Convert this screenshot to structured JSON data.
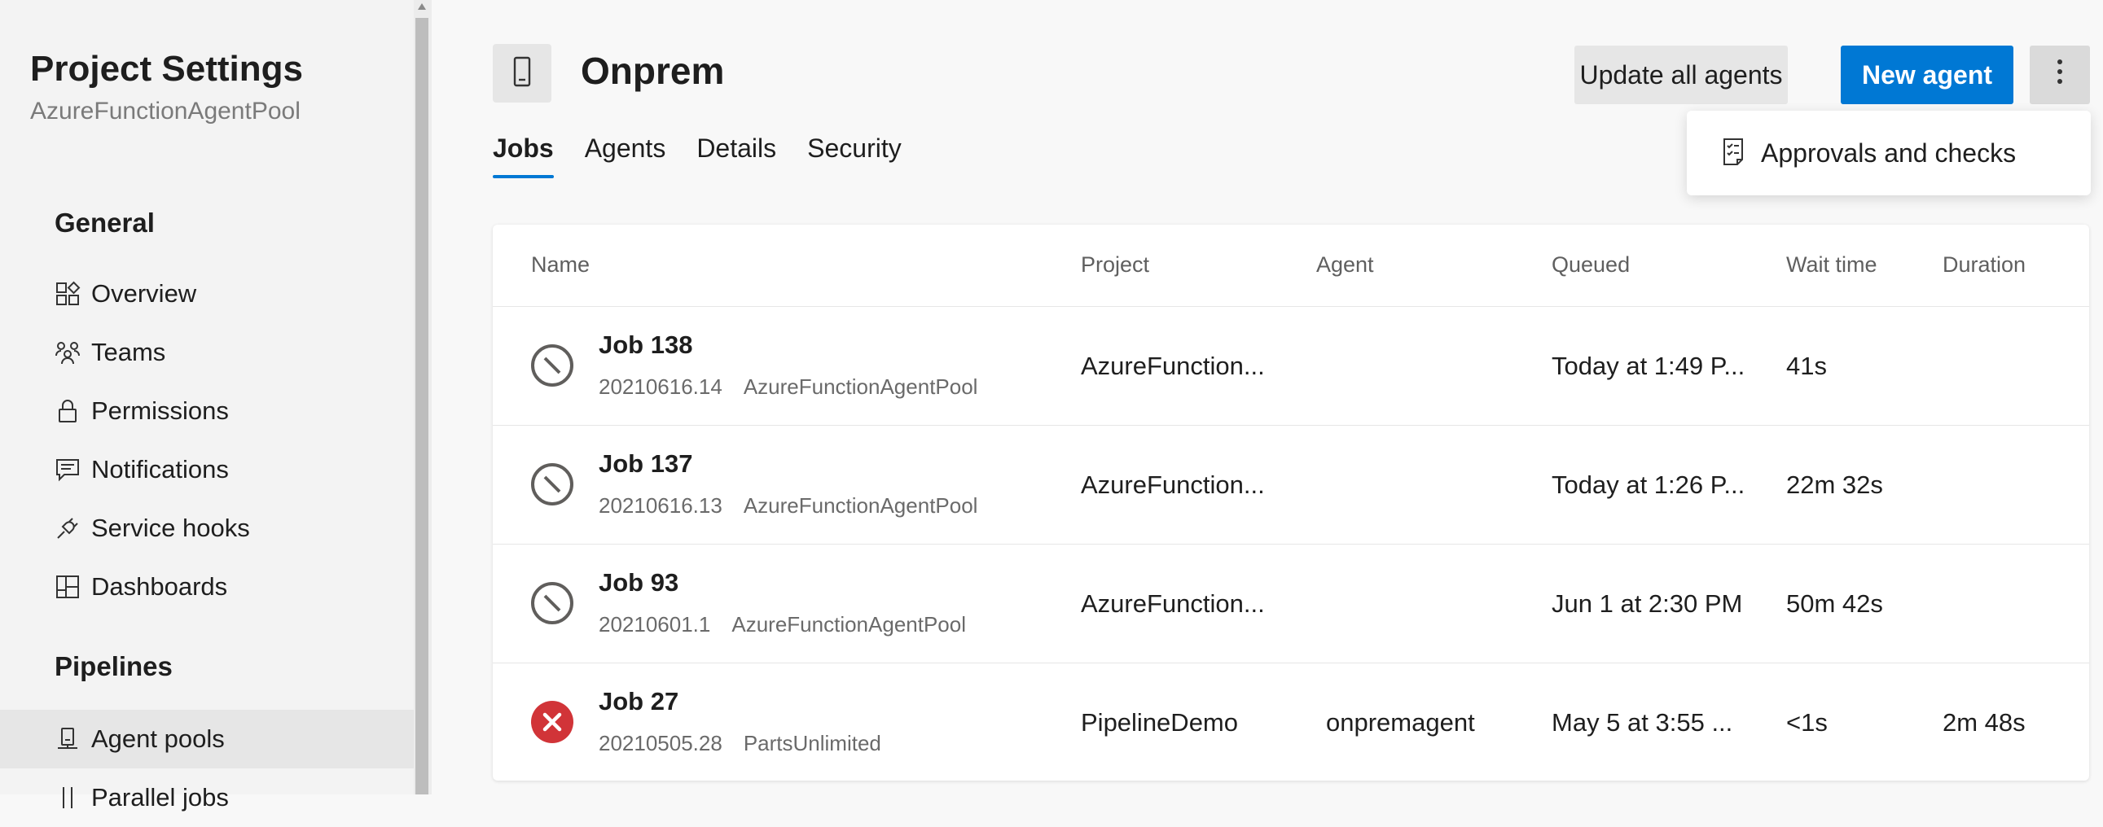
{
  "sidebar": {
    "title": "Project Settings",
    "subtitle": "AzureFunctionAgentPool",
    "sections": [
      {
        "heading": "General",
        "items": [
          {
            "label": "Overview",
            "icon": "overview-icon"
          },
          {
            "label": "Teams",
            "icon": "teams-icon"
          },
          {
            "label": "Permissions",
            "icon": "lock-icon"
          },
          {
            "label": "Notifications",
            "icon": "notifications-icon"
          },
          {
            "label": "Service hooks",
            "icon": "service-hooks-icon"
          },
          {
            "label": "Dashboards",
            "icon": "dashboards-icon"
          }
        ]
      },
      {
        "heading": "Pipelines",
        "items": [
          {
            "label": "Agent pools",
            "icon": "agent-pools-icon",
            "selected": true
          },
          {
            "label": "Parallel jobs",
            "icon": "parallel-jobs-icon"
          }
        ]
      }
    ]
  },
  "header": {
    "title": "Onprem",
    "update_label": "Update all agents",
    "new_agent_label": "New agent",
    "more_icon": "more-vertical-icon"
  },
  "tabs": [
    {
      "label": "Jobs",
      "active": true
    },
    {
      "label": "Agents"
    },
    {
      "label": "Details"
    },
    {
      "label": "Security"
    }
  ],
  "dropdown": {
    "items": [
      {
        "label": "Approvals and checks",
        "icon": "checklist-icon"
      }
    ]
  },
  "table": {
    "columns": [
      "Name",
      "Project",
      "Agent",
      "Queued",
      "Wait time",
      "Duration"
    ],
    "rows": [
      {
        "status": "canceled",
        "name": "Job 138",
        "build": "20210616.14",
        "pipeline": "AzureFunctionAgentPool",
        "project": "AzureFunction...",
        "agent": "",
        "queued": "Today at 1:49 P...",
        "wait": "41s",
        "duration": ""
      },
      {
        "status": "canceled",
        "name": "Job 137",
        "build": "20210616.13",
        "pipeline": "AzureFunctionAgentPool",
        "project": "AzureFunction...",
        "agent": "",
        "queued": "Today at 1:26 P...",
        "wait": "22m 32s",
        "duration": ""
      },
      {
        "status": "canceled",
        "name": "Job 93",
        "build": "20210601.1",
        "pipeline": "AzureFunctionAgentPool",
        "project": "AzureFunction...",
        "agent": "",
        "queued": "Jun 1 at 2:30 PM",
        "wait": "50m 42s",
        "duration": ""
      },
      {
        "status": "failed",
        "name": "Job 27",
        "build": "20210505.28",
        "pipeline": "PartsUnlimited",
        "project": "PipelineDemo",
        "agent": "onpremagent",
        "queued": "May 5 at 3:55 ...",
        "wait": "<1s",
        "duration": "2m 48s"
      }
    ]
  },
  "colors": {
    "accent": "#0078d4",
    "failed": "#d13438",
    "canceled": "#605e5c"
  }
}
